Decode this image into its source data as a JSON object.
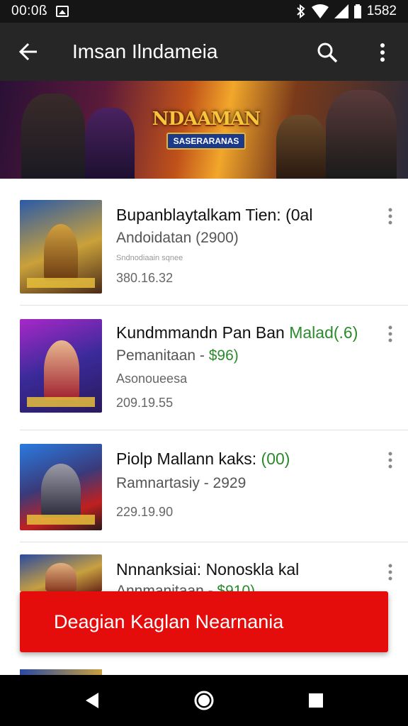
{
  "status_bar": {
    "time": "00:0ß",
    "right_text": "1582"
  },
  "app_bar": {
    "title": "Imsan Ilndameia"
  },
  "banner": {
    "logo_title": "NDAAMAN",
    "logo_subtitle": "SASERARANAS"
  },
  "items": [
    {
      "title": "Bupanblaytalkam Tien: (0al",
      "title_accent": "",
      "subtitle": "Andoidatan  (2900)",
      "price": "",
      "tiny": "Sndnodiaain sqnee",
      "meta": "380.16.32"
    },
    {
      "title": "Kundmmandn Pan Ban ",
      "title_accent": "Malad(.6)",
      "subtitle": "Pemanitaan - ",
      "price": "$96)",
      "tiny": "",
      "meta_top": "Asonoueesa",
      "meta": "209.19.55"
    },
    {
      "title": "Piolp Mallann kaks: ",
      "title_accent": "(00)",
      "subtitle": "Ramnartasiy - 2929",
      "price": "",
      "tiny": "",
      "meta": "229.19.90"
    },
    {
      "title": "Nnnanksiai: Nonoskla kal",
      "title_accent": "",
      "subtitle": "Annmanitaan - ",
      "price": "$910)",
      "tiny": "",
      "meta": ""
    }
  ],
  "cta": {
    "label": "Deagian Kaglan Nearnania"
  },
  "colors": {
    "app_bar": "#262626",
    "cta": "#e50c0c",
    "accent_green": "#2b8a2b"
  }
}
